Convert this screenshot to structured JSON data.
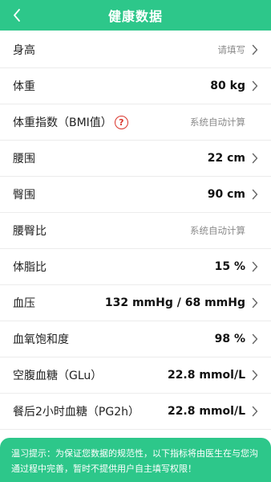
{
  "header": {
    "title": "健康数据",
    "back_icon": "chevron-left-icon"
  },
  "rows": [
    {
      "label": "身高",
      "hint": "请填写",
      "chevron": true
    },
    {
      "label": "体重",
      "value": "80 kg",
      "chevron": true
    },
    {
      "label": "体重指数（BMI值）",
      "help": "?",
      "hint": "系统自动计算",
      "chevron": false
    },
    {
      "label": "腰围",
      "value": "22 cm",
      "chevron": true
    },
    {
      "label": "臀围",
      "value": "90 cm",
      "chevron": true
    },
    {
      "label": "腰臀比",
      "hint": "系统自动计算",
      "chevron": false
    },
    {
      "label": "体脂比",
      "value": "15 %",
      "chevron": true
    },
    {
      "label": "血压",
      "value": "132 mmHg / 68 mmHg",
      "chevron": true
    },
    {
      "label": "血氧饱和度",
      "value": "98 %",
      "chevron": true
    },
    {
      "label": "空腹血糖（GLu）",
      "value": "22.8 mmol/L",
      "chevron": true
    },
    {
      "label": "餐后2小时血糖（PG2h）",
      "value": "22.8 mmol/L",
      "chevron": true
    }
  ],
  "notice": {
    "text": "温习提示：为保证您数据的规范性，以下指标将由医生在与您沟通过程中完善，暂时不提供用户自主填写权限！"
  },
  "colors": {
    "accent": "#2dc78a",
    "help_red": "#d9342b"
  }
}
